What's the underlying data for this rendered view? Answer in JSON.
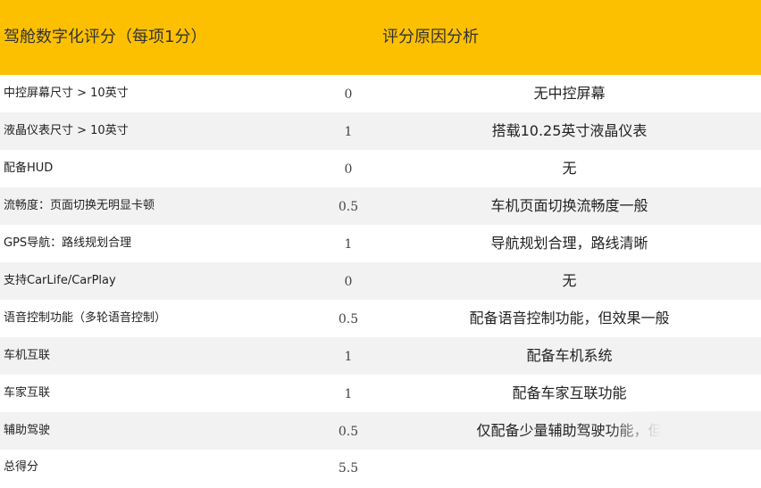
{
  "header": {
    "item_col": "驾舱数字化评分（每项1分）",
    "reason_col": "评分原因分析"
  },
  "rows": [
    {
      "item": "中控屏幕尺寸 > 10英寸",
      "score": "0",
      "reason": "无中控屏幕"
    },
    {
      "item": "液晶仪表尺寸 > 10英寸",
      "score": "1",
      "reason": "搭载10.25英寸液晶仪表"
    },
    {
      "item": "配备HUD",
      "score": "0",
      "reason": "无"
    },
    {
      "item": "流畅度：页面切换无明显卡顿",
      "score": "0.5",
      "reason": "车机页面切换流畅度一般"
    },
    {
      "item": "GPS导航：路线规划合理",
      "score": "1",
      "reason": "导航规划合理，路线清晰"
    },
    {
      "item": "支持CarLife/CarPlay",
      "score": "0",
      "reason": "无"
    },
    {
      "item": "语音控制功能（多轮语音控制）",
      "score": "0.5",
      "reason": "配备语音控制功能，但效果一般"
    },
    {
      "item": "车机互联",
      "score": "1",
      "reason": "配备车机系统"
    },
    {
      "item": "车家互联",
      "score": "1",
      "reason": "配备车家互联功能"
    },
    {
      "item": "辅助驾驶",
      "score": "0.5",
      "reason": "仅配备少量辅助驾驶功能，但"
    },
    {
      "item": "总得分",
      "score": "5.5",
      "reason": ""
    }
  ]
}
